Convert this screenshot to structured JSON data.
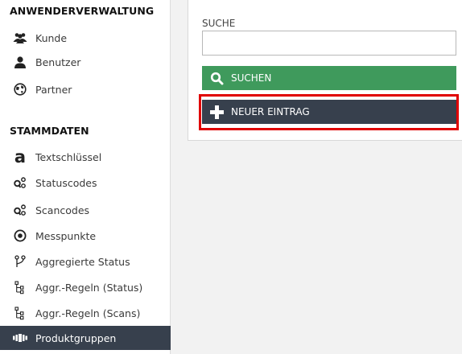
{
  "sidebar": {
    "section1_title": "ANWENDERVERWALTUNG",
    "section1_items": [
      {
        "label": "Kunde",
        "icon": "users-icon"
      },
      {
        "label": "Benutzer",
        "icon": "user-icon"
      },
      {
        "label": "Partner",
        "icon": "globe-icon"
      }
    ],
    "section2_title": "STAMMDATEN",
    "section2_items": [
      {
        "label": "Textschlüssel",
        "icon": "letter-a-icon"
      },
      {
        "label": "Statuscodes",
        "icon": "status-codes-icon"
      },
      {
        "label": "Scancodes",
        "icon": "scan-codes-icon"
      },
      {
        "label": "Messpunkte",
        "icon": "target-icon"
      },
      {
        "label": "Aggregierte Status",
        "icon": "branch-icon"
      },
      {
        "label": "Aggr.-Regeln (Status)",
        "icon": "tree-icon"
      },
      {
        "label": "Aggr.-Regeln (Scans)",
        "icon": "tree-icon"
      },
      {
        "label": "Produktgruppen",
        "icon": "product-group-icon",
        "active": true
      }
    ]
  },
  "search": {
    "label": "SUCHE",
    "value": "",
    "search_button": "SUCHEN",
    "new_button": "NEUER EINTRAG"
  },
  "colors": {
    "sidebar_active": "#37404d",
    "search_button": "#3f9a5c",
    "new_button": "#37404d",
    "highlight": "#e00000"
  }
}
